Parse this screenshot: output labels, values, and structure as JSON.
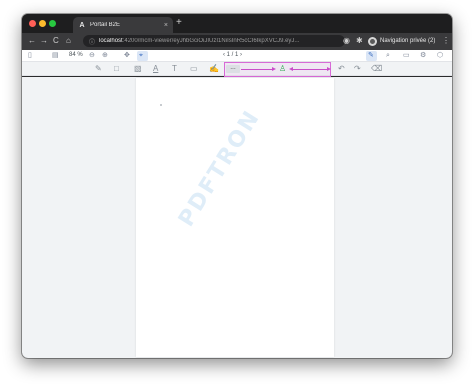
{
  "browser": {
    "tab": {
      "favicon": "A",
      "title": "Portail B2E",
      "close": "×"
    },
    "new_tab": "+",
    "nav": {
      "back": "←",
      "forward": "→",
      "reload": "C",
      "home": "⌂"
    },
    "address": {
      "info_icon": "ⓘ",
      "host": "localhost",
      "path": ":4200/mcm-viewer/eyJhbGciOiJIUzI1NiIsInR5cCI6IkpXVCJ9.eyJ..."
    },
    "profile": {
      "label": "Navigation privée (2)"
    },
    "extensions": [
      "extension-icon",
      "puzzle-icon"
    ],
    "menu": "⋮"
  },
  "viewer": {
    "zoom": "84 %",
    "page_nav": {
      "prev": "‹",
      "current": "1",
      "separator": "/",
      "total": "1",
      "next": "›",
      "display": "‹  1 / 1  ›"
    },
    "watermark": "PDFTRON",
    "tools_selected_label": "---",
    "colors": {
      "highlight_border": "#d76ad6",
      "arrow": "#c94ec8",
      "stamp": "#2fa84f"
    }
  }
}
